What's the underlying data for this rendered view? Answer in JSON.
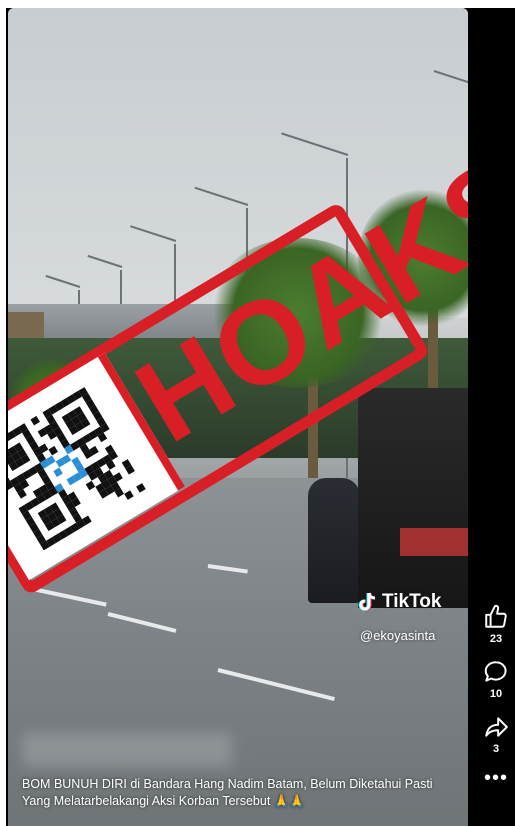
{
  "video": {
    "stamp_text": "HOAKS",
    "watermark": {
      "brand": "TikTok",
      "handle": "@ekoyasinta"
    },
    "caption": "BOM BUNUH DIRI di Bandara Hang Nadim Batam, Belum Diketahui Pasti Yang Melatarbelakangi Aksi Korban Tersebut 🙏🙏"
  },
  "actions": [
    {
      "name": "like",
      "icon": "thumbs-up-icon",
      "count": "23"
    },
    {
      "name": "comment",
      "icon": "comment-icon",
      "count": "10"
    },
    {
      "name": "share",
      "icon": "share-icon",
      "count": "3"
    },
    {
      "name": "more",
      "icon": "more-dots-icon",
      "label": "•••"
    }
  ],
  "colors": {
    "stamp": "#d91f26",
    "background": "#000000"
  }
}
